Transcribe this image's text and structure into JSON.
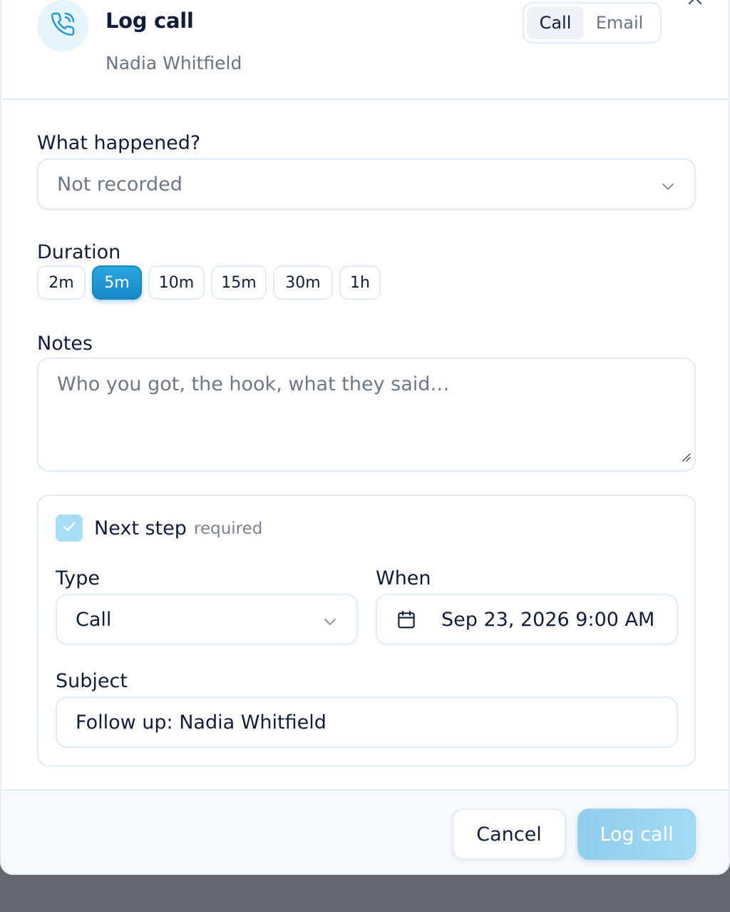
{
  "header": {
    "title": "Log call",
    "contact_name": "Nadia Whitfield",
    "mode_tabs": [
      {
        "label": "Call",
        "active": true
      },
      {
        "label": "Email",
        "active": false
      }
    ]
  },
  "outcome": {
    "label": "What happened?",
    "value": "Not recorded"
  },
  "duration": {
    "label": "Duration",
    "options": [
      "2m",
      "5m",
      "10m",
      "15m",
      "30m",
      "1h"
    ],
    "selected": "5m"
  },
  "notes": {
    "label": "Notes",
    "placeholder": "Who you got, the hook, what they said…",
    "value": ""
  },
  "next_step": {
    "checkbox_label": "Next step",
    "required_text": "required",
    "checked": true,
    "type_label": "Type",
    "type_value": "Call",
    "when_label": "When",
    "when_value": "Sep 23, 2026 9:00 AM",
    "subject_label": "Subject",
    "subject_value": "Follow up: Nadia Whitfield"
  },
  "footer": {
    "cancel_label": "Cancel",
    "submit_label": "Log call"
  },
  "colors": {
    "accent": "#1f97d4",
    "submit_disabled": "#9ed6f1",
    "text": "#111c3a",
    "muted": "#6a7384",
    "border": "#e3ebf5"
  },
  "icons": {
    "avatar": "phone-icon",
    "close": "close-icon",
    "dropdown": "chevron-down-icon",
    "calendar": "calendar-icon",
    "checkbox": "check-icon"
  }
}
